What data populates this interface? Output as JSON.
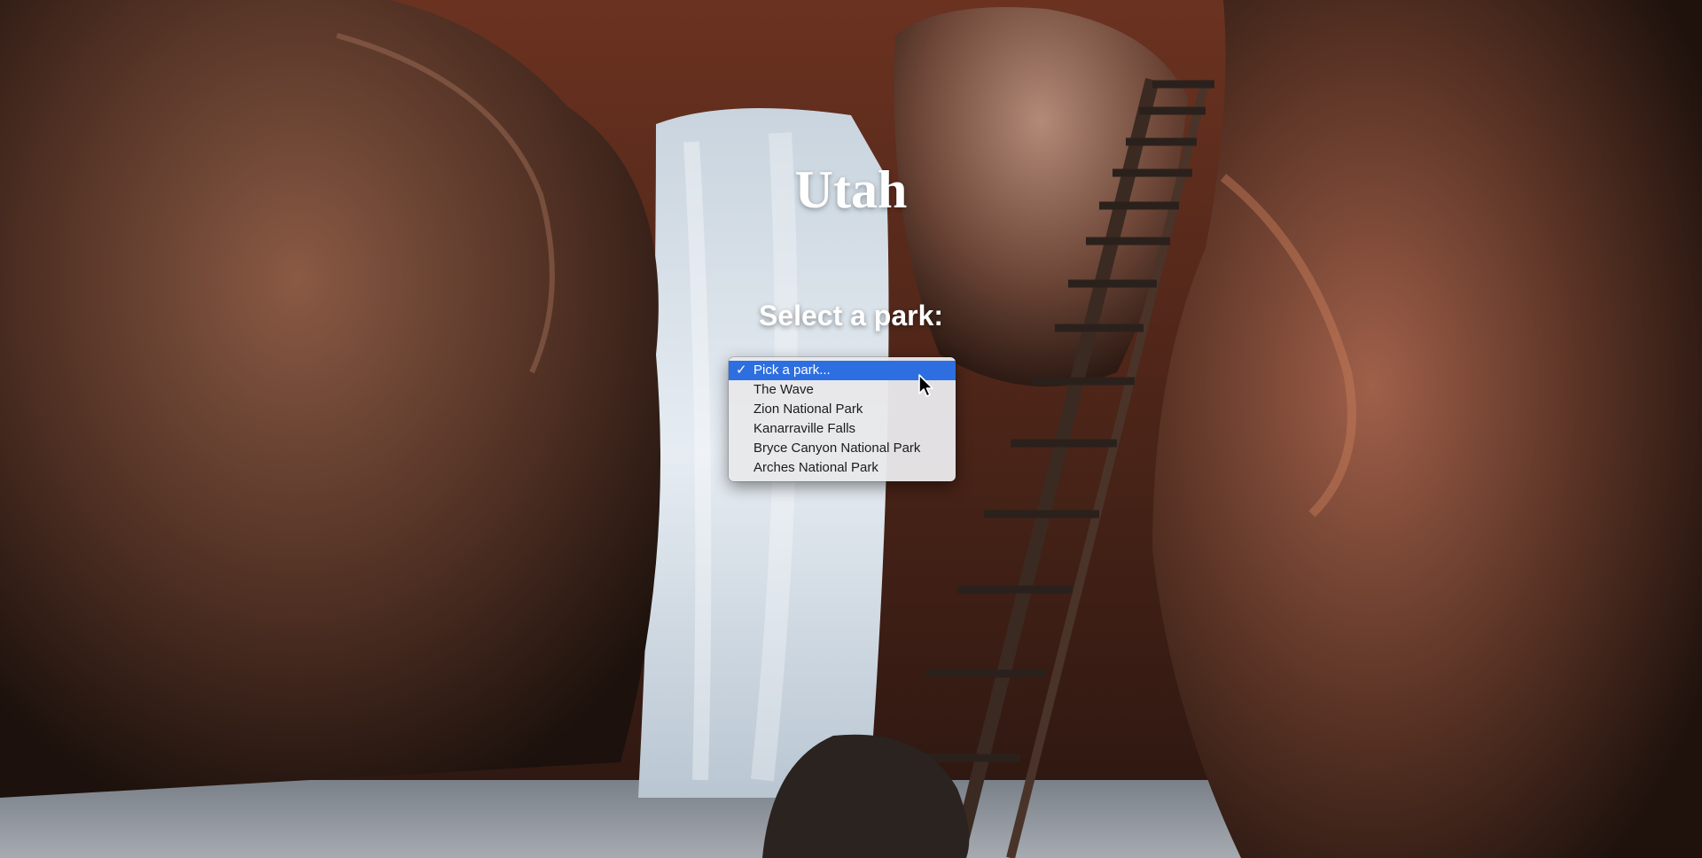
{
  "page": {
    "title": "Utah",
    "prompt": "Select a park:"
  },
  "park_select": {
    "selected_index": 0,
    "options": [
      {
        "label": "Pick a park...",
        "selected": true
      },
      {
        "label": "The Wave",
        "selected": false
      },
      {
        "label": "Zion National Park",
        "selected": false
      },
      {
        "label": "Kanarraville Falls",
        "selected": false
      },
      {
        "label": "Bryce Canyon National Park",
        "selected": false
      },
      {
        "label": "Arches National Park",
        "selected": false
      }
    ],
    "check_icon": "checkmark-icon"
  },
  "colors": {
    "highlight": "#2d6fe0",
    "menu_bg": "#e8e8ea",
    "title_text": "#ffffff"
  }
}
